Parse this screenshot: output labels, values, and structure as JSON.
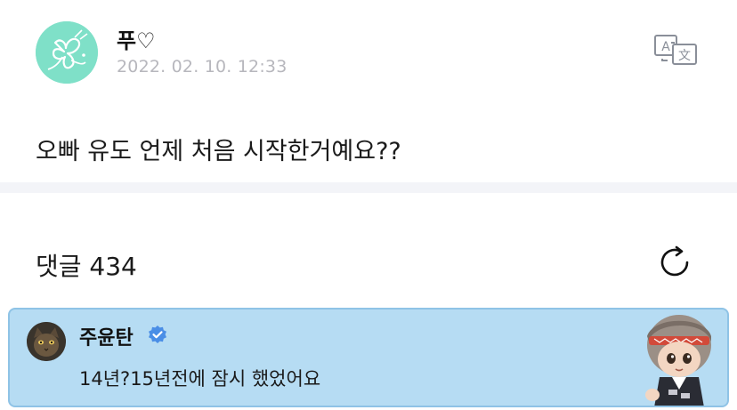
{
  "post": {
    "author": "푸♡",
    "timestamp": "2022. 02. 10. 12:33",
    "text": "오빠 유도 언제 처음 시작한거예요??"
  },
  "comments": {
    "header": "댓글 434"
  },
  "reply": {
    "author": "주윤탄",
    "text": "14년?15년전에 잠시 했었어요"
  },
  "icons": {
    "translate": "translate-icon",
    "refresh": "refresh-icon",
    "verified": "verified-check-icon"
  },
  "colors": {
    "avatar_mint": "#7fe0c8",
    "reply_background": "#b6dcf3",
    "reply_border": "#8fc3e6",
    "verified_blue": "#4a8ee6",
    "timestamp_gray": "#b7b7bd"
  }
}
